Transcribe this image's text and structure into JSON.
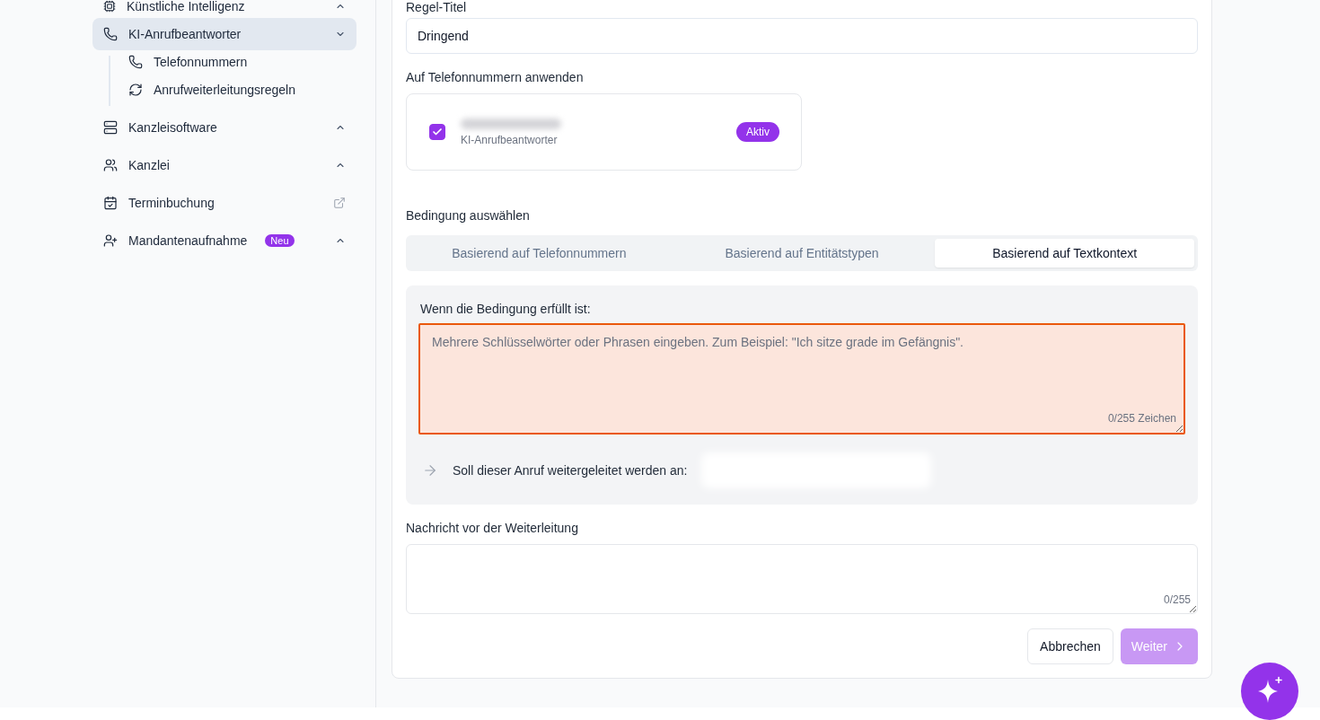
{
  "sidebar": {
    "items": [
      {
        "kind": "group",
        "label": "Künstliche Intelligenz",
        "selected": false,
        "expanded": false
      },
      {
        "kind": "group",
        "label": "KI-Anrufbeantworter",
        "selected": true,
        "expanded": true,
        "children": [
          {
            "label": "Telefonnummern",
            "selected": false
          },
          {
            "label": "Anrufweiterleitungsregeln",
            "selected": false
          }
        ]
      },
      {
        "kind": "group",
        "label": "Kanzleisoftware",
        "selected": false,
        "expanded": false
      },
      {
        "kind": "group",
        "label": "Kanzlei",
        "selected": false,
        "expanded": false
      },
      {
        "kind": "external",
        "label": "Terminbuchung",
        "selected": false
      },
      {
        "kind": "group",
        "label": "Mandantenaufnahme",
        "badge": "Neu",
        "selected": false,
        "expanded": false
      }
    ]
  },
  "rule_title": {
    "label": "Regel-Titel",
    "value": "Dringend"
  },
  "phone_numbers": {
    "label": "Auf Telefonnummern anwenden",
    "items": [
      {
        "subtitle": "KI-Anrufbeantworter",
        "checked": true,
        "status": "Aktiv"
      }
    ]
  },
  "condition": {
    "label": "Bedingung auswählen",
    "tabs": [
      {
        "label": "Basierend auf Telefonnummern",
        "selected": false
      },
      {
        "label": "Basierend auf Entitätstypen",
        "selected": false
      },
      {
        "label": "Basierend auf Textkontext",
        "selected": true
      }
    ],
    "trigger_label": "Wenn die Bedingung erfüllt ist:",
    "keywords": {
      "placeholder": "Mehrere Schlüsselwörter oder Phrasen eingeben. Zum Beispiel: \"Ich sitze grade im Gefängnis\".",
      "counter": "0/255 Zeichen",
      "invalid": true
    },
    "forward_label": "Soll dieser Anruf weitergeleitet werden an:"
  },
  "message": {
    "label": "Nachricht vor der Weiterleitung",
    "counter": "0/255"
  },
  "buttons": [
    {
      "kind": "secondary",
      "label": "Abbrechen",
      "disabled": false
    },
    {
      "kind": "primary",
      "label": "Weiter",
      "disabled": true
    }
  ]
}
